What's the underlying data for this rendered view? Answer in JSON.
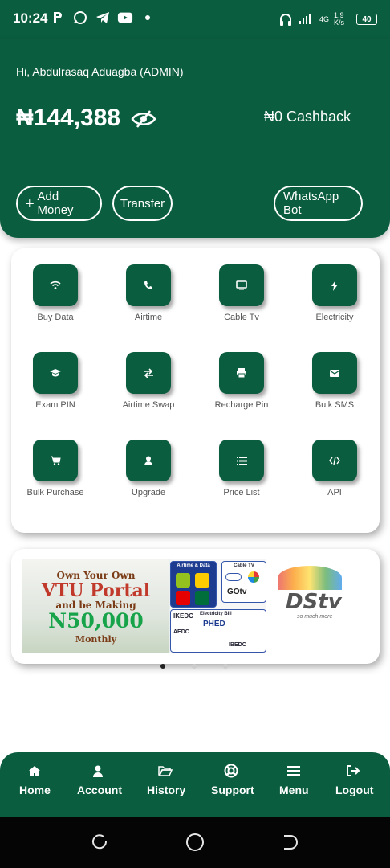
{
  "status_bar": {
    "time": "10:24",
    "network": "4G",
    "speed": "1.9 K/s",
    "battery": "40"
  },
  "header": {
    "greeting": "Hi, Abdulrasaq Aduagba (ADMIN)",
    "balance": "₦144,388",
    "cashback": "₦0 Cashback",
    "buttons": {
      "add_money": "Add Money",
      "transfer": "Transfer",
      "whatsapp": "WhatsApp Bot"
    }
  },
  "services": [
    {
      "label": "Buy Data",
      "icon": "wifi-icon"
    },
    {
      "label": "Airtime",
      "icon": "phone-icon"
    },
    {
      "label": "Cable Tv",
      "icon": "tv-icon"
    },
    {
      "label": "Electricity",
      "icon": "bolt-icon"
    },
    {
      "label": "Exam PIN",
      "icon": "graduation-cap-icon"
    },
    {
      "label": "Airtime Swap",
      "icon": "swap-icon"
    },
    {
      "label": "Recharge Pin",
      "icon": "printer-icon"
    },
    {
      "label": "Bulk SMS",
      "icon": "envelope-icon"
    },
    {
      "label": "Bulk Purchase",
      "icon": "cart-icon"
    },
    {
      "label": "Upgrade",
      "icon": "user-icon"
    },
    {
      "label": "Price List",
      "icon": "list-icon"
    },
    {
      "label": "API",
      "icon": "code-icon"
    }
  ],
  "banner": {
    "line1": "Own Your Own",
    "line2": "VTU Portal",
    "line3": "and be Making",
    "line4": "N50,000",
    "line5": "Monthly",
    "airtime_data": "Airtime & Data",
    "cable_tv": "Cable TV",
    "electricity_bill": "Electricity Bill",
    "gotv": "GOtv",
    "phed": "PHED",
    "aedc": "AEDC",
    "ikedc": "IKEDC",
    "ibedc": "IBEDC",
    "dstv": "DStv",
    "dstv_tagline": "so much more"
  },
  "carousel": {
    "count": 3,
    "active": 0
  },
  "bottom_nav": [
    {
      "label": "Home",
      "icon": "home-icon"
    },
    {
      "label": "Account",
      "icon": "user-icon"
    },
    {
      "label": "History",
      "icon": "folder-open-icon"
    },
    {
      "label": "Support",
      "icon": "lifebuoy-icon"
    },
    {
      "label": "Menu",
      "icon": "menu-icon"
    },
    {
      "label": "Logout",
      "icon": "logout-icon"
    }
  ]
}
